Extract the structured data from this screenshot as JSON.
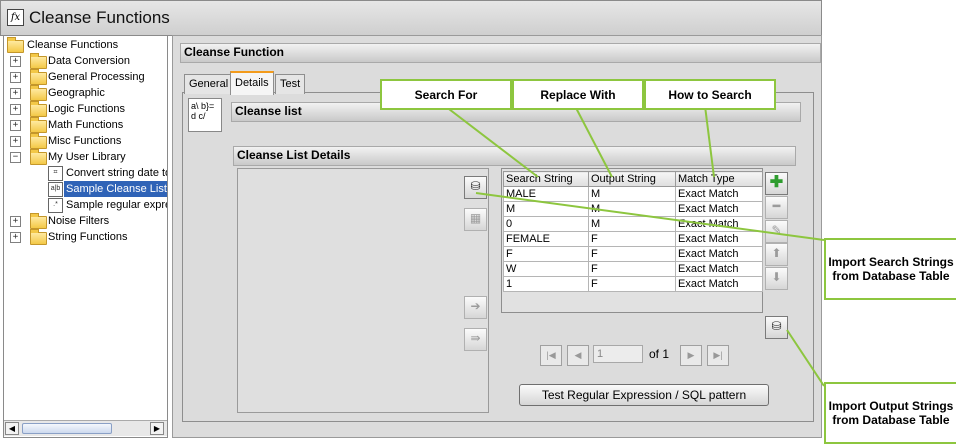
{
  "window": {
    "title": "Cleanse Functions",
    "icon": "function-icon"
  },
  "tree": {
    "root": "Cleanse Functions",
    "items": [
      {
        "label": "Data Conversion"
      },
      {
        "label": "General Processing"
      },
      {
        "label": "Geographic"
      },
      {
        "label": "Logic Functions"
      },
      {
        "label": "Math Functions"
      },
      {
        "label": "Misc Functions"
      },
      {
        "label": "My User Library"
      },
      {
        "label": "Convert string date to"
      },
      {
        "label": "Sample Cleanse List"
      },
      {
        "label": "Sample regular expre"
      },
      {
        "label": "Noise Filters"
      },
      {
        "label": "String Functions"
      }
    ]
  },
  "main": {
    "header": "Cleanse Function",
    "tabs": [
      "General",
      "Details",
      "Test"
    ],
    "active_tab": "Details",
    "cleanse_list_title": "Cleanse list",
    "details_title": "Cleanse List Details",
    "icon_text": "a\\ b}= d c/",
    "table": {
      "columns": [
        "Search String",
        "Output String",
        "Match Type"
      ],
      "rows": [
        [
          "MALE",
          "M",
          "Exact Match"
        ],
        [
          "M",
          "M",
          "Exact Match"
        ],
        [
          "0",
          "M",
          "Exact Match"
        ],
        [
          "FEMALE",
          "F",
          "Exact Match"
        ],
        [
          "F",
          "F",
          "Exact Match"
        ],
        [
          "W",
          "F",
          "Exact Match"
        ],
        [
          "1",
          "F",
          "Exact Match"
        ]
      ]
    },
    "pagination": {
      "page": "1",
      "of_label": "of",
      "total": "1"
    },
    "test_button": "Test Regular Expression / SQL pattern"
  },
  "callouts": {
    "search_for": "Search For",
    "replace_with": "Replace With",
    "how_to_search": "How to Search",
    "import_search": "Import Search Strings from Database Table",
    "import_output": "Import Output Strings from Database Table"
  },
  "colors": {
    "accent_tab": "#f39b1b",
    "callout_border": "#8dc63f",
    "add_button": "#2e9c2e",
    "selection": "#2f63b7"
  }
}
